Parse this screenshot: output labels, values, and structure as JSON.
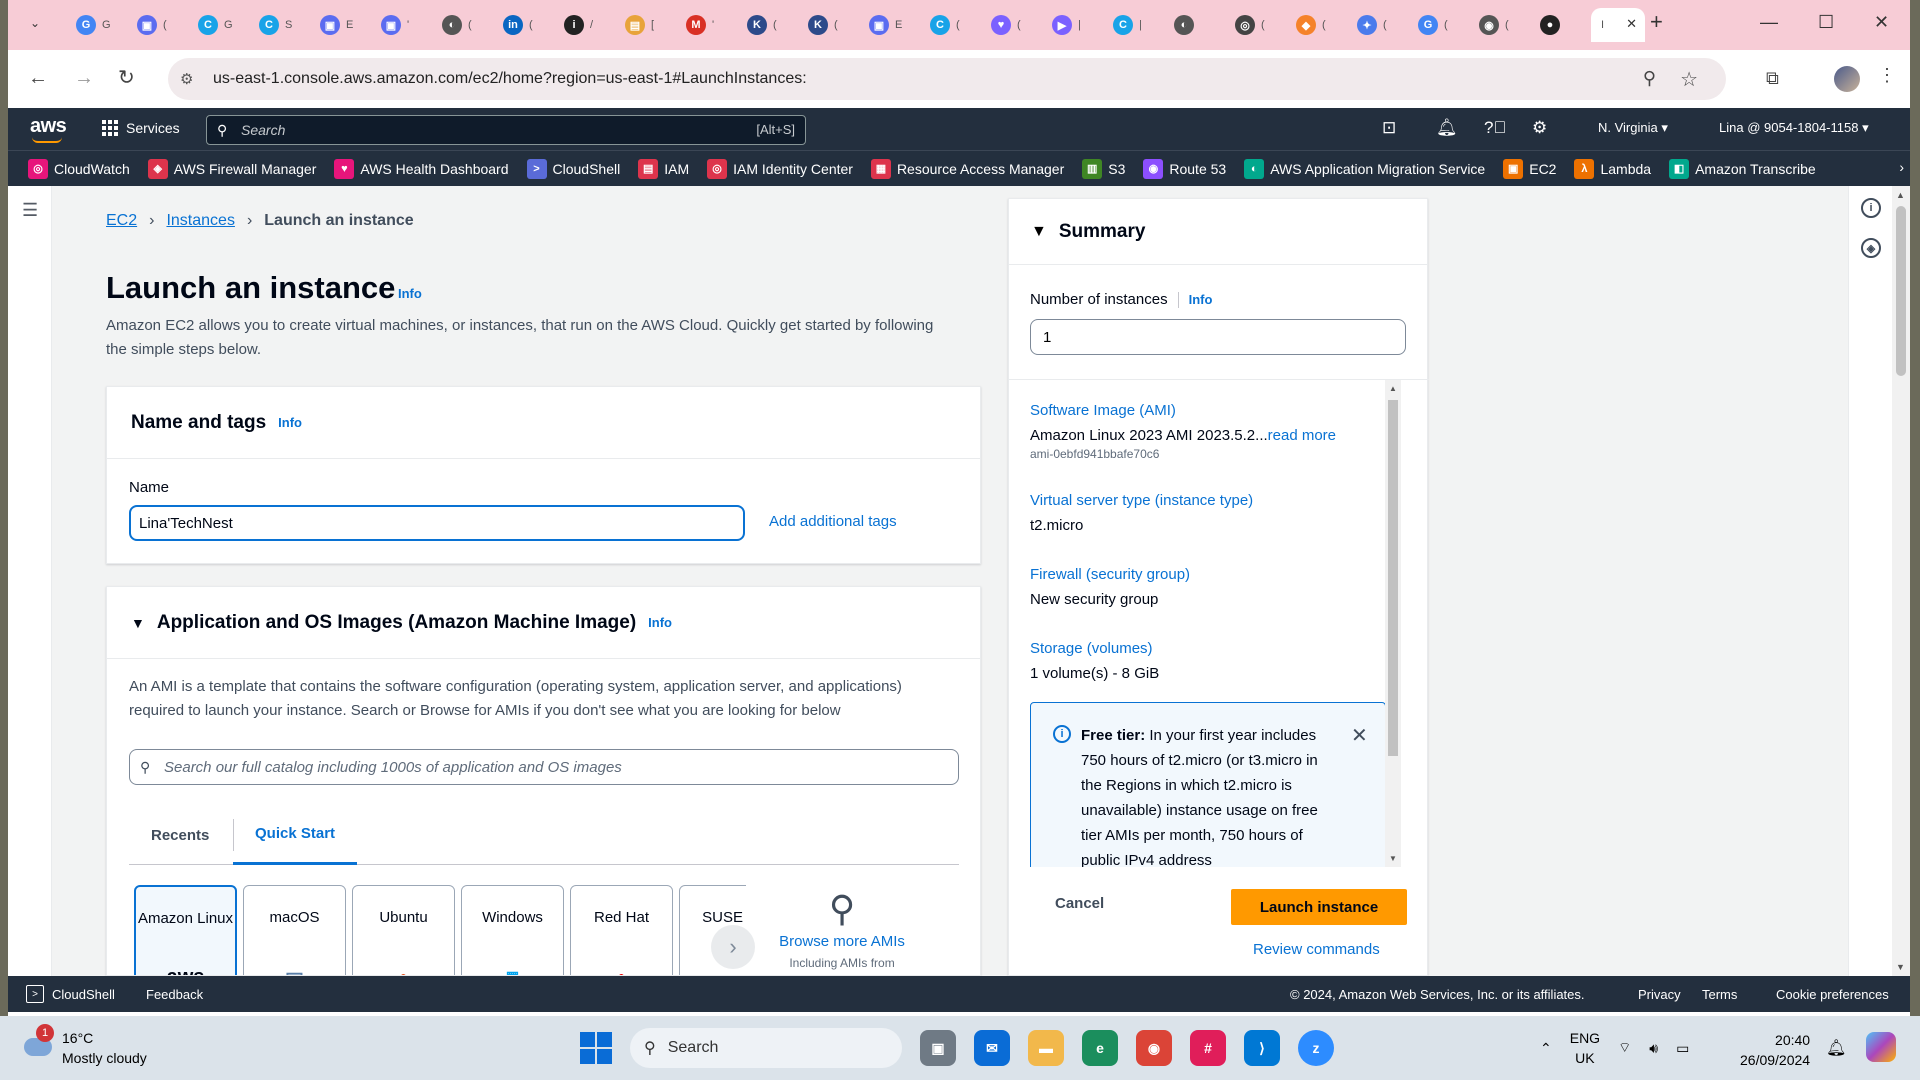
{
  "browser": {
    "tabs": [
      {
        "letter": "G",
        "color": "#4285f4",
        "title": "G"
      },
      {
        "letter": "▣",
        "color": "#5b6cf0",
        "title": "("
      },
      {
        "letter": "C",
        "color": "#19a3e8",
        "title": "G"
      },
      {
        "letter": "C",
        "color": "#19a3e8",
        "title": "S"
      },
      {
        "letter": "▣",
        "color": "#5b6cf0",
        "title": "E"
      },
      {
        "letter": "▣",
        "color": "#5b6cf0",
        "title": "'"
      },
      {
        "letter": "◐",
        "color": "#555555",
        "title": "("
      },
      {
        "letter": "in",
        "color": "#0a66c2",
        "title": "("
      },
      {
        "letter": "i",
        "color": "#222222",
        "title": "/"
      },
      {
        "letter": "▤",
        "color": "#e8a33a",
        "title": "["
      },
      {
        "letter": "M",
        "color": "#d93025",
        "title": "'"
      },
      {
        "letter": "K",
        "color": "#2d4a8a",
        "title": "("
      },
      {
        "letter": "K",
        "color": "#2d4a8a",
        "title": "("
      },
      {
        "letter": "▣",
        "color": "#5b6cf0",
        "title": "E"
      },
      {
        "letter": "C",
        "color": "#19a3e8",
        "title": "("
      },
      {
        "letter": "♥",
        "color": "#7b61ff",
        "title": "("
      },
      {
        "letter": "▶",
        "color": "#7b61ff",
        "title": "|"
      },
      {
        "letter": "C",
        "color": "#19a3e8",
        "title": "|"
      },
      {
        "letter": "◐",
        "color": "#555555",
        "title": ""
      },
      {
        "letter": "◎",
        "color": "#444444",
        "title": "("
      },
      {
        "letter": "◆",
        "color": "#f5822a",
        "title": "("
      },
      {
        "letter": "✦",
        "color": "#4b7bec",
        "title": "("
      },
      {
        "letter": "G",
        "color": "#4285f4",
        "title": "("
      },
      {
        "letter": "◉",
        "color": "#555555",
        "title": "("
      },
      {
        "letter": "●",
        "color": "#222222",
        "title": ""
      }
    ],
    "active_tab_title": "I",
    "url": "us-east-1.console.aws.amazon.com/ec2/home?region=us-east-1#LaunchInstances:"
  },
  "awsnav": {
    "logo": "aws",
    "services": "Services",
    "search_placeholder": "Search",
    "search_shortcut": "[Alt+S]",
    "region": "N. Virginia ▾",
    "account": "Lina @ 9054-1804-1158 ▾"
  },
  "favorites": [
    {
      "label": "CloudWatch",
      "color": "#e7157b",
      "icon": "◎"
    },
    {
      "label": "AWS Firewall Manager",
      "color": "#dd344c",
      "icon": "◈"
    },
    {
      "label": "AWS Health Dashboard",
      "color": "#e7157b",
      "icon": "♥"
    },
    {
      "label": "CloudShell",
      "color": "#5a6bd8",
      "icon": ">"
    },
    {
      "label": "IAM",
      "color": "#dd344c",
      "icon": "▤"
    },
    {
      "label": "IAM Identity Center",
      "color": "#dd344c",
      "icon": "◎"
    },
    {
      "label": "Resource Access Manager",
      "color": "#dd344c",
      "icon": "▦"
    },
    {
      "label": "S3",
      "color": "#3f8624",
      "icon": "▥"
    },
    {
      "label": "Route 53",
      "color": "#8c4fff",
      "icon": "◉"
    },
    {
      "label": "AWS Application Migration Service",
      "color": "#01a88d",
      "icon": "◐"
    },
    {
      "label": "EC2",
      "color": "#ed7100",
      "icon": "▣"
    },
    {
      "label": "Lambda",
      "color": "#ed7100",
      "icon": "λ"
    },
    {
      "label": "Amazon Transcribe",
      "color": "#01a88d",
      "icon": "◧"
    }
  ],
  "breadcrumb": {
    "ec2": "EC2",
    "instances": "Instances",
    "current": "Launch an instance"
  },
  "page": {
    "title": "Launch an instance",
    "info": "Info",
    "description": "Amazon EC2 allows you to create virtual machines, or instances, that run on the AWS Cloud. Quickly get started by following the simple steps below."
  },
  "name_tags": {
    "heading": "Name and tags",
    "info": "Info",
    "name_label": "Name",
    "name_value": "Lina'TechNest",
    "add_tags": "Add additional tags"
  },
  "ami": {
    "heading": "Application and OS Images (Amazon Machine Image)",
    "info": "Info",
    "description": "An AMI is a template that contains the software configuration (operating system, application server, and applications) required to launch your instance. Search or Browse for AMIs if you don't see what you are looking for below",
    "search_placeholder": "Search our full catalog including 1000s of application and OS images",
    "tabs": [
      "Recents",
      "Quick Start"
    ],
    "os_options": [
      "Amazon Linux",
      "macOS",
      "Ubuntu",
      "Windows",
      "Red Hat",
      "SUSE Li"
    ],
    "amazon_logo": "aws",
    "browse_more": "Browse more AMIs",
    "browse_sub": "Including AMIs from"
  },
  "summary": {
    "heading": "Summary",
    "num_label": "Number of instances",
    "info": "Info",
    "num_value": "1",
    "software_label": "Software Image (AMI)",
    "software_value": "Amazon Linux 2023 AMI 2023.5.2...",
    "read_more": "read more",
    "ami_id": "ami-0ebfd941bbafe70c6",
    "instance_label": "Virtual server type (instance type)",
    "instance_value": "t2.micro",
    "firewall_label": "Firewall (security group)",
    "firewall_value": "New security group",
    "storage_label": "Storage (volumes)",
    "storage_value": "1 volume(s) - 8 GiB",
    "free_tier_bold": "Free tier:",
    "free_tier_text": " In your first year includes 750 hours of t2.micro (or t3.micro in the Regions in which t2.micro is unavailable) instance usage on free tier AMIs per month, 750 hours of public IPv4 address",
    "cancel": "Cancel",
    "launch": "Launch instance",
    "review": "Review commands"
  },
  "footer": {
    "cloudshell": "CloudShell",
    "feedback": "Feedback",
    "copyright": "© 2024, Amazon Web Services, Inc. or its affiliates.",
    "privacy": "Privacy",
    "terms": "Terms",
    "cookies": "Cookie preferences"
  },
  "taskbar": {
    "weather_temp": "16°C",
    "weather_desc": "Mostly cloudy",
    "weather_badge": "1",
    "search": "Search",
    "lang1": "ENG",
    "lang2": "UK",
    "time": "20:40",
    "date": "26/09/2024"
  }
}
